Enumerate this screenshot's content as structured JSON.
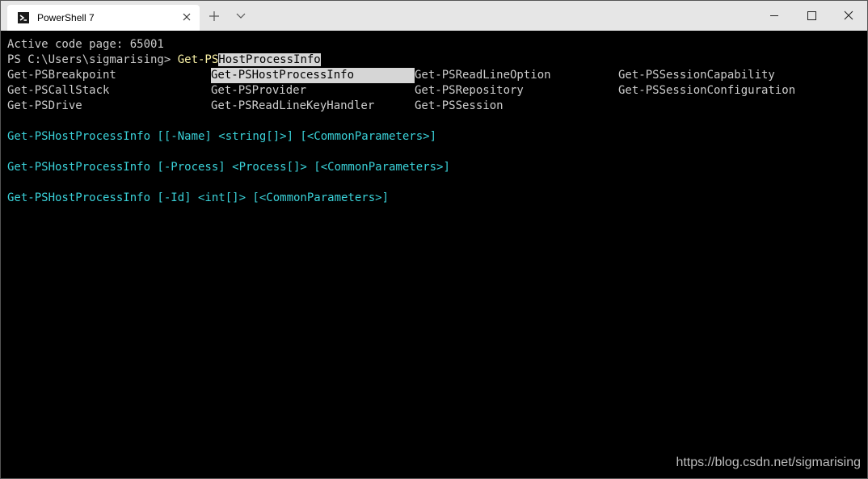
{
  "window": {
    "tab_title": "PowerShell 7",
    "watermark": "https://blog.csdn.net/sigmarising"
  },
  "terminal": {
    "code_page": "Active code page: 65001",
    "prompt": "PS C:\\Users\\sigmarising> ",
    "typed": "Get-PS",
    "selected_completion": "HostProcessInfo",
    "completions": [
      [
        "Get-PSBreakpoint",
        "Get-PSHostProcessInfo",
        "Get-PSReadLineOption",
        "Get-PSSessionCapability"
      ],
      [
        "Get-PSCallStack",
        "Get-PSProvider",
        "Get-PSRepository",
        "Get-PSSessionConfiguration"
      ],
      [
        "Get-PSDrive",
        "Get-PSReadLineKeyHandler",
        "Get-PSSession",
        ""
      ]
    ],
    "syntax": [
      "Get-PSHostProcessInfo [[-Name] <string[]>] [<CommonParameters>]",
      "Get-PSHostProcessInfo [-Process] <Process[]> [<CommonParameters>]",
      "Get-PSHostProcessInfo [-Id] <int[]> [<CommonParameters>]"
    ]
  }
}
